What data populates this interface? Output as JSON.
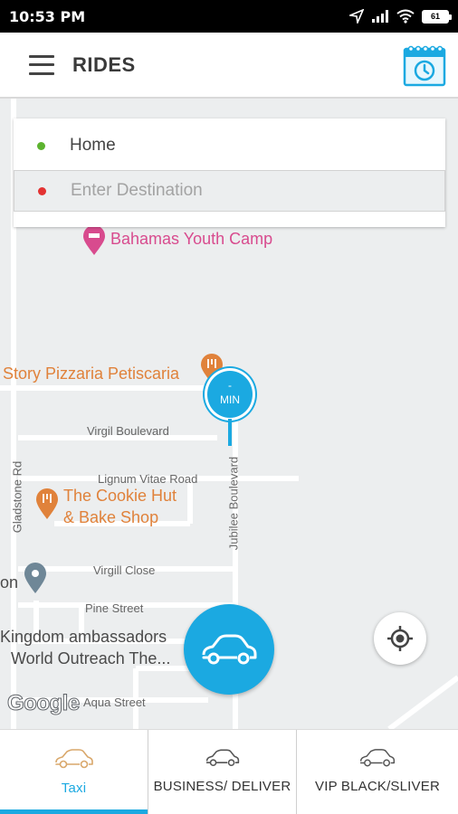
{
  "status_bar": {
    "time": "10:53 PM",
    "battery": "61"
  },
  "app_bar": {
    "title": "RIDES",
    "menu_icon": "hamburger-menu-icon",
    "calendar_icon": "calendar-schedule-icon"
  },
  "search": {
    "pickup": "Home",
    "destination_placeholder": "Enter Destination"
  },
  "eta_pin": {
    "value": "-",
    "unit": "MIN"
  },
  "map": {
    "pois": {
      "bahamas": "Bahamas Youth Camp",
      "pizzaria": "Story Pizzaria Petiscaria",
      "cookie_line1": "The Cookie Hut",
      "cookie_line2": "& Bake Shop",
      "kingdom_line1": "Kingdom ambassadors",
      "kingdom_line2": "World Outreach The...",
      "on": "on"
    },
    "streets": {
      "virgil_boulevard": "Virgil Boulevard",
      "lignum": "Lignum Vitae Road",
      "gladstone": "Gladstone Rd",
      "jubilee": "Jubilee Boulevard",
      "virgill_close": "Virgill Close",
      "pine": "Pine Street",
      "aqua": "Aqua Street"
    },
    "attribution": "Google"
  },
  "tabs": [
    {
      "label": "Taxi",
      "active": true,
      "car_color": "#d9a76a"
    },
    {
      "label": "BUSINESS/ DELIVER",
      "active": false,
      "car_color": "#555555"
    },
    {
      "label": "VIP BLACK/SLIVER",
      "active": false,
      "car_color": "#555555"
    }
  ],
  "colors": {
    "accent": "#1ba9e1",
    "pickup_dot": "#5cb32f",
    "destination_dot": "#e33232"
  }
}
